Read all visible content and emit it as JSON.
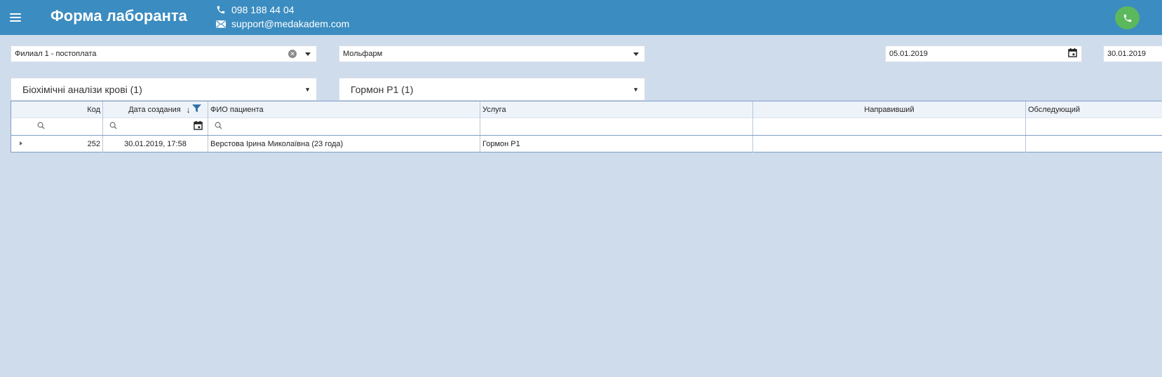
{
  "header": {
    "title": "Форма лаборанта",
    "phone": "098 188 44 04",
    "email": "support@medakadem.com",
    "bg_color": "#3b8cc0",
    "call_button_color": "#5cb85c"
  },
  "filters": {
    "branch": "Филиал 1 - постоплата",
    "laboratory": "Мольфарм",
    "date_from": "05.01.2019",
    "date_to": "30.01.2019",
    "category": "Біохімічні аналізи крові (1)",
    "service": "Гормон Р1 (1)"
  },
  "grid": {
    "columns": [
      "Код",
      "Дата создания",
      "ФИО пациента",
      "Услуга",
      "Направивший",
      "Обследующий"
    ],
    "rows": [
      {
        "code": "252",
        "created": "30.01.2019, 17:58",
        "patient": "Верстова Ірина Миколаївна (23 года)",
        "service": "Гормон Р1",
        "referrer": "",
        "examiner": ""
      }
    ]
  },
  "icons": [
    "menu-icon",
    "phone-icon",
    "mail-icon",
    "call-icon",
    "clear-icon",
    "dropdown-arrow-icon",
    "calendar-icon",
    "sort-desc-icon",
    "filter-icon",
    "search-icon",
    "row-expander-icon"
  ]
}
